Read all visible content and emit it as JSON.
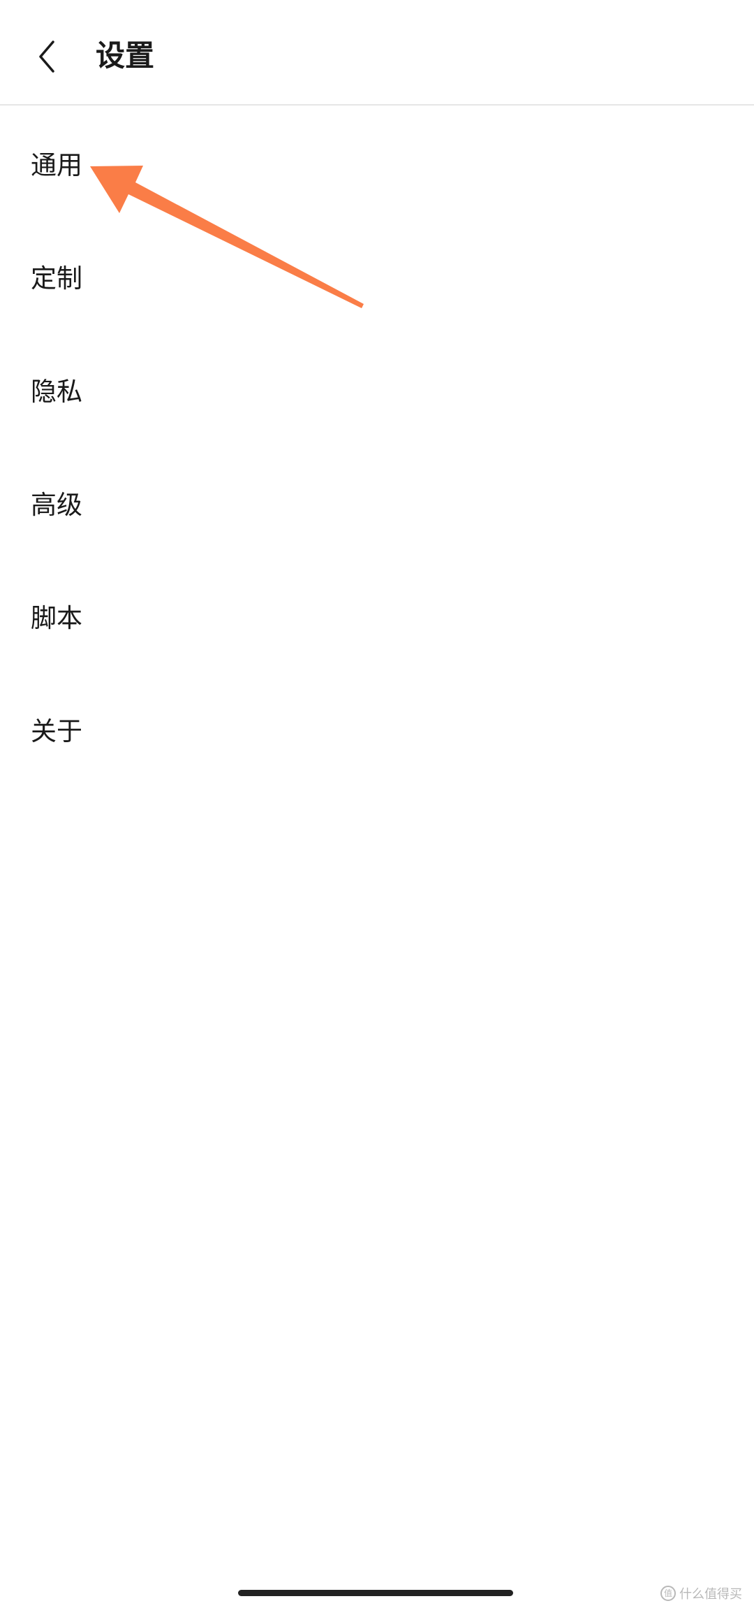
{
  "header": {
    "title": "设置",
    "back_icon": "chevron-left-icon"
  },
  "settings_items": [
    {
      "label": "通用"
    },
    {
      "label": "定制"
    },
    {
      "label": "隐私"
    },
    {
      "label": "高级"
    },
    {
      "label": "脚本"
    },
    {
      "label": "关于"
    }
  ],
  "watermark": {
    "logo_char": "值",
    "text": "什么值得买"
  },
  "colors": {
    "background": "#FFFFFF",
    "text": "#1A1A1A",
    "divider": "#E6E6E6",
    "annotation_arrow": "#FA7D47",
    "home_indicator": "#222222",
    "watermark": "#B8B8B8"
  }
}
